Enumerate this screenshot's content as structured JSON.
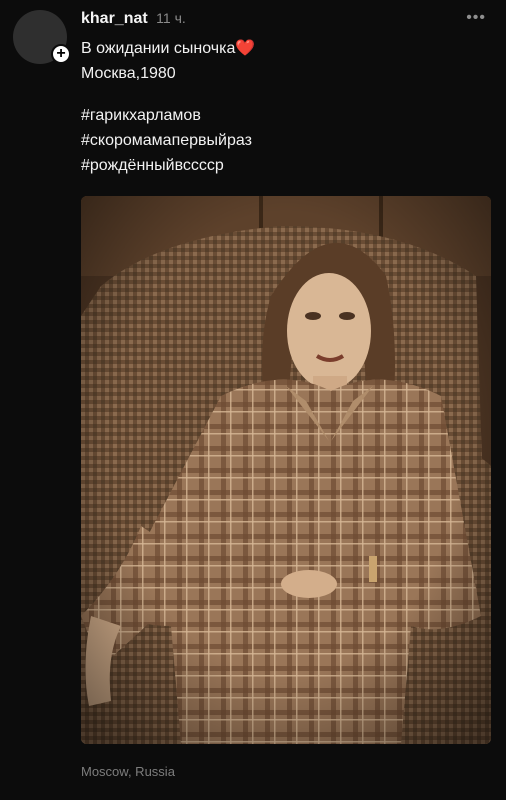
{
  "post": {
    "username": "khar_nat",
    "time": "11 ч.",
    "caption_line1": "В ожидании сыночка",
    "caption_emoji": "❤️",
    "caption_line2": "Москва,1980",
    "hashtags": [
      "#гарикхарламов",
      "#скоромамапервыйраз",
      "#рождённыйвсссср"
    ],
    "location": "Moscow, Russia",
    "more_icon": "more-horizontal-icon",
    "plus_icon": "plus-icon"
  },
  "colors": {
    "background": "#0c0c0c",
    "text": "#f2f2f2",
    "muted": "#8a8a8a",
    "heart": "#e8343b"
  }
}
